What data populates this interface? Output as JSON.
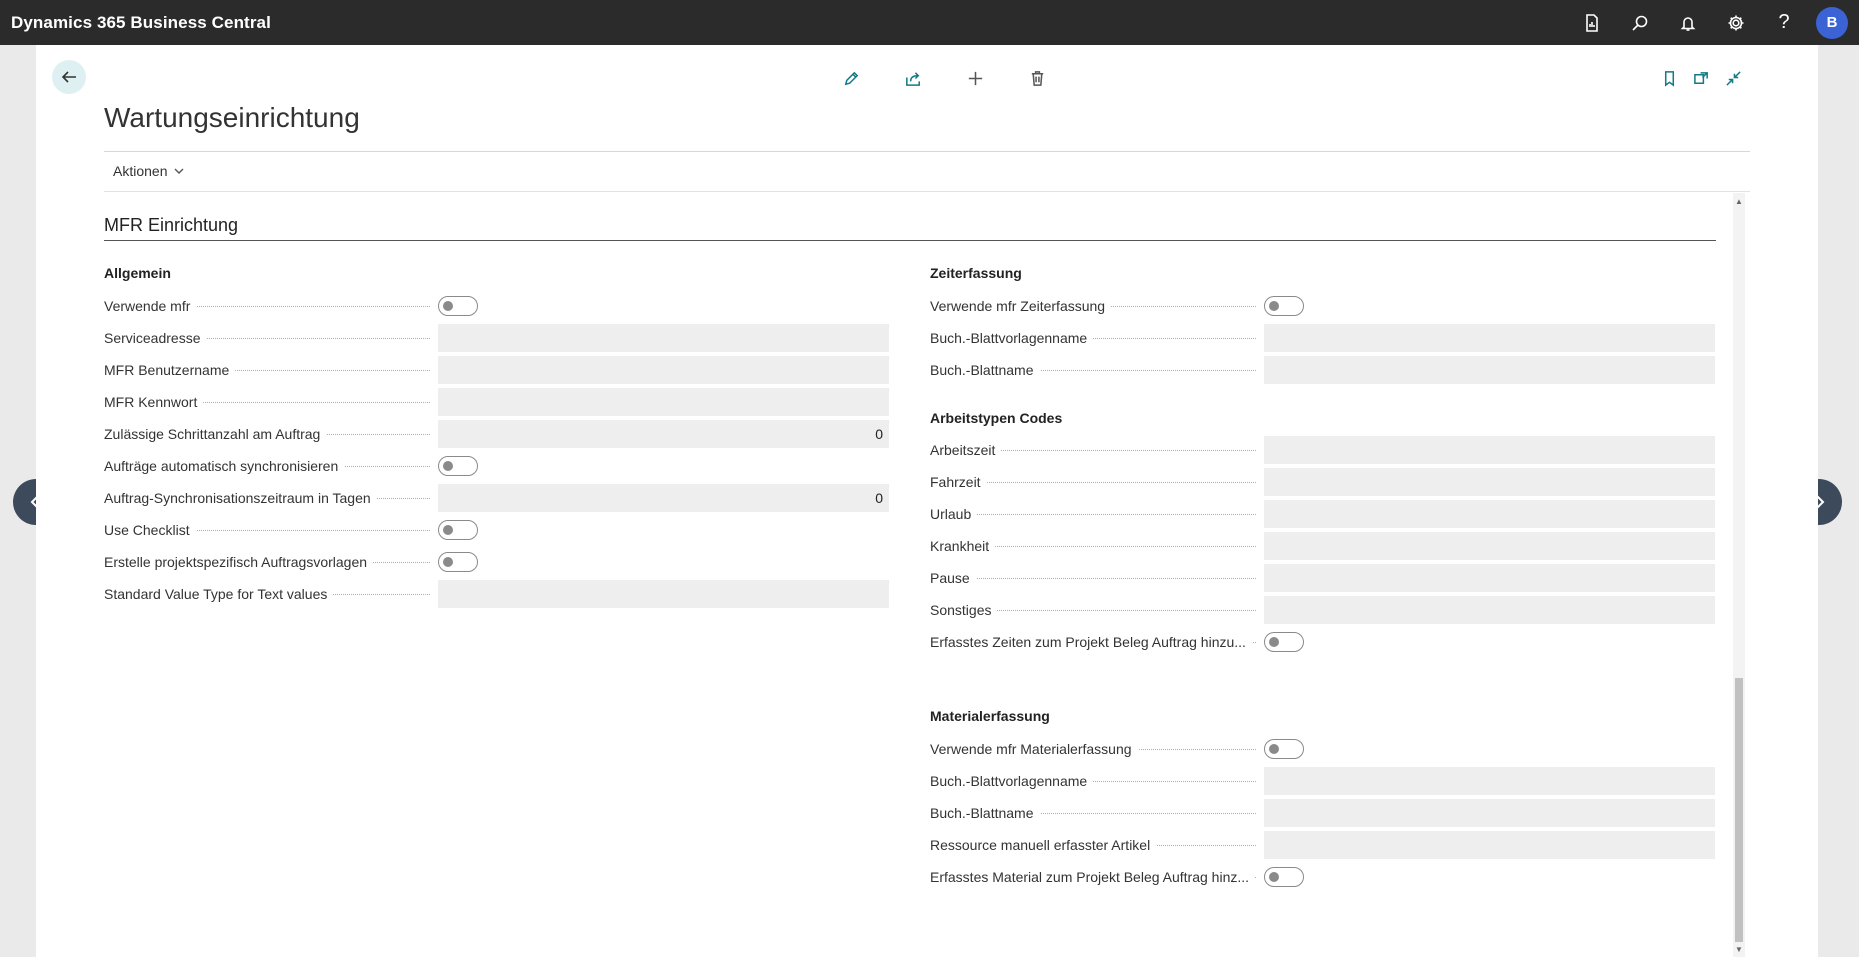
{
  "app": {
    "title": "Dynamics 365 Business Central",
    "avatar_letter": "B"
  },
  "topbar_icons": [
    "reports-icon",
    "search-icon",
    "bell-icon",
    "gear-icon",
    "help-icon"
  ],
  "help_glyph": "?",
  "page": {
    "title": "Wartungseinrichtung",
    "actions_label": "Aktionen"
  },
  "section": {
    "title": "MFR Einrichtung"
  },
  "allgemein": {
    "heading": "Allgemein",
    "fields": [
      {
        "label": "Verwende mfr",
        "type": "toggle",
        "value": ""
      },
      {
        "label": "Serviceadresse",
        "type": "text",
        "value": ""
      },
      {
        "label": "MFR Benutzername",
        "type": "text",
        "value": ""
      },
      {
        "label": "MFR Kennwort",
        "type": "text",
        "value": ""
      },
      {
        "label": "Zulässige Schrittanzahl am Auftrag",
        "type": "text",
        "value": "0"
      },
      {
        "label": "Aufträge automatisch synchronisieren",
        "type": "toggle",
        "value": ""
      },
      {
        "label": "Auftrag-Synchronisationszeitraum in Tagen",
        "type": "text",
        "value": "0"
      },
      {
        "label": "Use Checklist",
        "type": "toggle",
        "value": ""
      },
      {
        "label": "Erstelle projektspezifisch Auftragsvorlagen",
        "type": "toggle",
        "value": ""
      },
      {
        "label": "Standard Value Type for Text values",
        "type": "text",
        "value": ""
      }
    ]
  },
  "zeiterfassung": {
    "heading": "Zeiterfassung",
    "fields": [
      {
        "label": "Verwende mfr Zeiterfassung",
        "type": "toggle",
        "value": ""
      },
      {
        "label": "Buch.-Blattvorlagenname",
        "type": "text",
        "value": ""
      },
      {
        "label": "Buch.-Blattname",
        "type": "text",
        "value": ""
      }
    ]
  },
  "arbeitstypen": {
    "heading": "Arbeitstypen Codes",
    "fields": [
      {
        "label": "Arbeitszeit",
        "type": "text",
        "value": ""
      },
      {
        "label": "Fahrzeit",
        "type": "text",
        "value": ""
      },
      {
        "label": "Urlaub",
        "type": "text",
        "value": ""
      },
      {
        "label": "Krankheit",
        "type": "text",
        "value": ""
      },
      {
        "label": "Pause",
        "type": "text",
        "value": ""
      },
      {
        "label": "Sonstiges",
        "type": "text",
        "value": ""
      },
      {
        "label": "Erfasstes Zeiten zum Projekt Beleg Auftrag hinzu...",
        "type": "toggle",
        "value": ""
      }
    ]
  },
  "materialerfassung": {
    "heading": "Materialerfassung",
    "fields": [
      {
        "label": "Verwende mfr Materialerfassung",
        "type": "toggle",
        "value": ""
      },
      {
        "label": "Buch.-Blattvorlagenname",
        "type": "text",
        "value": ""
      },
      {
        "label": "Buch.-Blattname",
        "type": "text",
        "value": ""
      },
      {
        "label": "Ressource manuell erfasster Artikel",
        "type": "text",
        "value": ""
      },
      {
        "label": "Erfasstes Material zum Projekt Beleg Auftrag hinz...",
        "type": "toggle",
        "value": ""
      }
    ]
  },
  "colors": {
    "topbar": "#2b2b2b",
    "accent": "#137a86",
    "avatar": "#3b63d6",
    "field": "#eeeeee",
    "nav": "#3d4a5c"
  }
}
